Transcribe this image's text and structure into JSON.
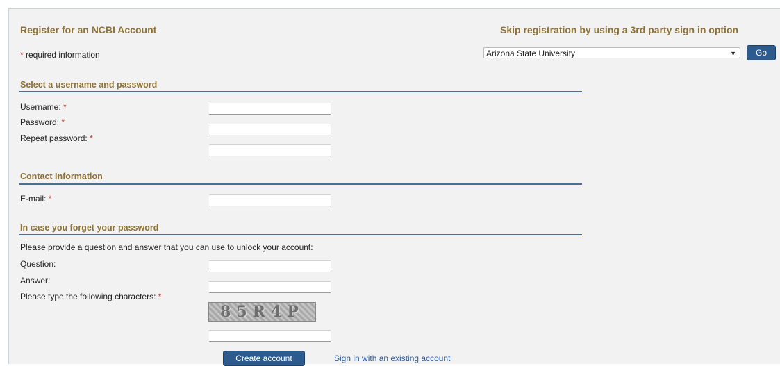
{
  "header": {
    "register_title": "Register for an NCBI Account",
    "skip_title": "Skip registration by using a 3rd party sign in option"
  },
  "required_note": {
    "asterisk": "*",
    "text": " required information"
  },
  "third_party": {
    "selected_provider": "Arizona State University",
    "go_label": "Go"
  },
  "sections": {
    "credentials": {
      "title": "Select a username and password",
      "username_label": "Username:",
      "password_label": "Password:",
      "repeat_password_label": "Repeat password:"
    },
    "contact": {
      "title": "Contact Information",
      "email_label": "E-mail:"
    },
    "forgot": {
      "title": "In case you forget your password",
      "instructions": "Please provide a question and answer that you can use to unlock your account:",
      "question_label": "Question:",
      "answer_label": "Answer:",
      "captcha_label": "Please type the following characters:",
      "captcha_text": "85R4P"
    }
  },
  "actions": {
    "create_label": "Create account",
    "signin_link": "Sign in with an existing account"
  },
  "colors": {
    "heading": "#8e7236",
    "rule": "#4f6d96",
    "button": "#2e5b8e",
    "required": "#c0392b"
  }
}
